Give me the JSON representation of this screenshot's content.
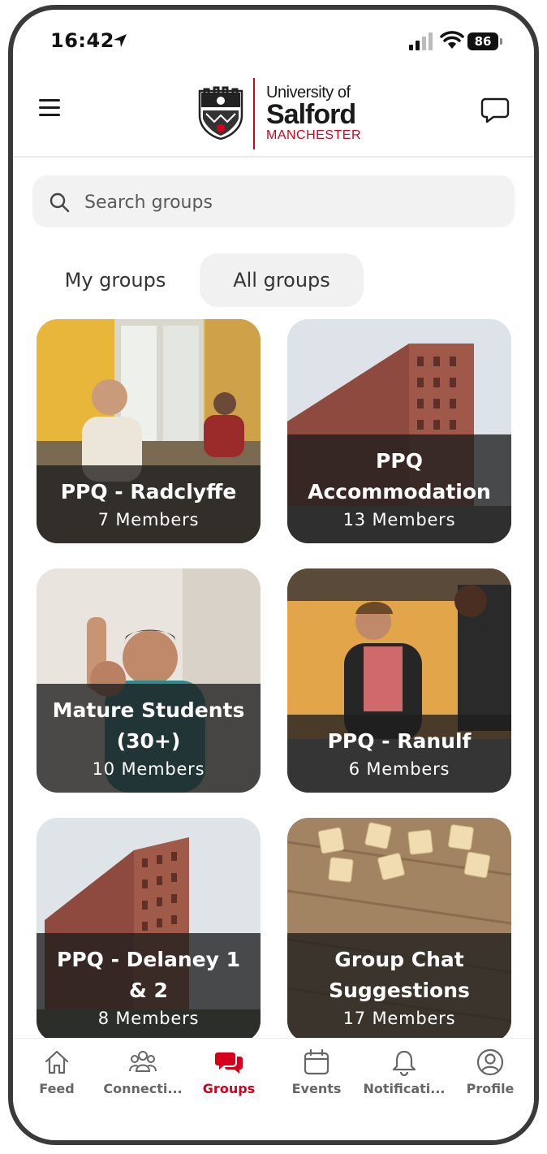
{
  "status_bar": {
    "time": "16:42",
    "battery": "86"
  },
  "header": {
    "logo": {
      "line1": "University of",
      "line2": "Salford",
      "line3": "MANCHESTER"
    }
  },
  "search": {
    "placeholder": "Search groups"
  },
  "tabs": [
    {
      "label": "My groups",
      "selected": false
    },
    {
      "label": "All groups",
      "selected": true
    }
  ],
  "groups": [
    {
      "title": "PPQ - Radclyffe",
      "members": "7 Members"
    },
    {
      "title": "PPQ Accommodation",
      "members": "13 Members"
    },
    {
      "title": "Mature Students (30+)",
      "members": "10 Members"
    },
    {
      "title": "PPQ - Ranulf",
      "members": "6 Members"
    },
    {
      "title": "PPQ - Delaney 1 & 2",
      "members": "8 Members"
    },
    {
      "title": "Group Chat Suggestions",
      "members": "17 Members"
    }
  ],
  "nav": [
    {
      "label": "Feed",
      "icon": "home-icon"
    },
    {
      "label": "Connecti...",
      "icon": "people-icon"
    },
    {
      "label": "Groups",
      "icon": "chat-bubbles-icon",
      "active": true
    },
    {
      "label": "Events",
      "icon": "calendar-icon"
    },
    {
      "label": "Notificati...",
      "icon": "bell-icon"
    },
    {
      "label": "Profile",
      "icon": "user-circle-icon"
    }
  ],
  "colors": {
    "accent": "#d6001c",
    "text": "#1a1a1a",
    "muted": "#666666"
  }
}
